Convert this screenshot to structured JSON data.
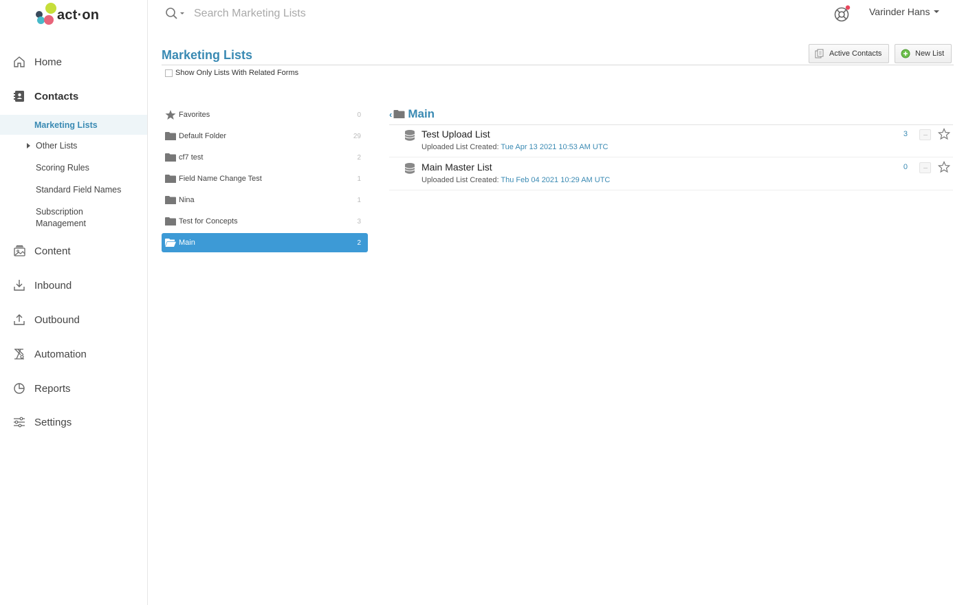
{
  "app": {
    "logo_text": "act·on"
  },
  "search": {
    "placeholder": "Search Marketing Lists"
  },
  "user": {
    "name": "Varinder Hans"
  },
  "sidebar": {
    "nav": [
      {
        "label": "Home",
        "icon": "home-icon"
      },
      {
        "label": "Contacts",
        "icon": "contacts-icon"
      },
      {
        "label": "Content",
        "icon": "content-icon"
      },
      {
        "label": "Inbound",
        "icon": "inbound-icon"
      },
      {
        "label": "Outbound",
        "icon": "outbound-icon"
      },
      {
        "label": "Automation",
        "icon": "automation-icon"
      },
      {
        "label": "Reports",
        "icon": "reports-icon"
      },
      {
        "label": "Settings",
        "icon": "settings-icon"
      }
    ],
    "contacts_sub": [
      {
        "label": "Marketing Lists"
      },
      {
        "label": "Other Lists"
      },
      {
        "label": "Scoring Rules"
      },
      {
        "label": "Standard Field Names"
      },
      {
        "label": "Subscription\nManagement"
      }
    ]
  },
  "page": {
    "title": "Marketing Lists",
    "active_contacts_label": "Active Contacts",
    "new_list_label": "New List",
    "filter_label": "Show Only Lists With Related Forms"
  },
  "folders": [
    {
      "name": "Favorites",
      "count": "0",
      "icon": "star-icon"
    },
    {
      "name": "Default Folder",
      "count": "29",
      "icon": "folder-icon"
    },
    {
      "name": "cf7 test",
      "count": "2",
      "icon": "folder-icon"
    },
    {
      "name": "Field Name Change Test",
      "count": "1",
      "icon": "folder-icon"
    },
    {
      "name": "Nina",
      "count": "1",
      "icon": "folder-icon"
    },
    {
      "name": "Test for Concepts",
      "count": "3",
      "icon": "folder-icon"
    },
    {
      "name": "Main",
      "count": "2",
      "icon": "folder-open-icon"
    }
  ],
  "panel": {
    "back_glyph": "‹",
    "title": "Main",
    "lists": [
      {
        "name": "Test Upload List",
        "meta_label": "Uploaded List Created:",
        "date": "Tue Apr 13 2021 10:53 AM UTC",
        "count": "3"
      },
      {
        "name": "Main Master List",
        "meta_label": "Uploaded List Created:",
        "date": "Thu Feb 04 2021 10:29 AM UTC",
        "count": "0"
      }
    ]
  },
  "colors": {
    "accent": "#3a8ab3",
    "selected_folder": "#3d9ad6"
  }
}
